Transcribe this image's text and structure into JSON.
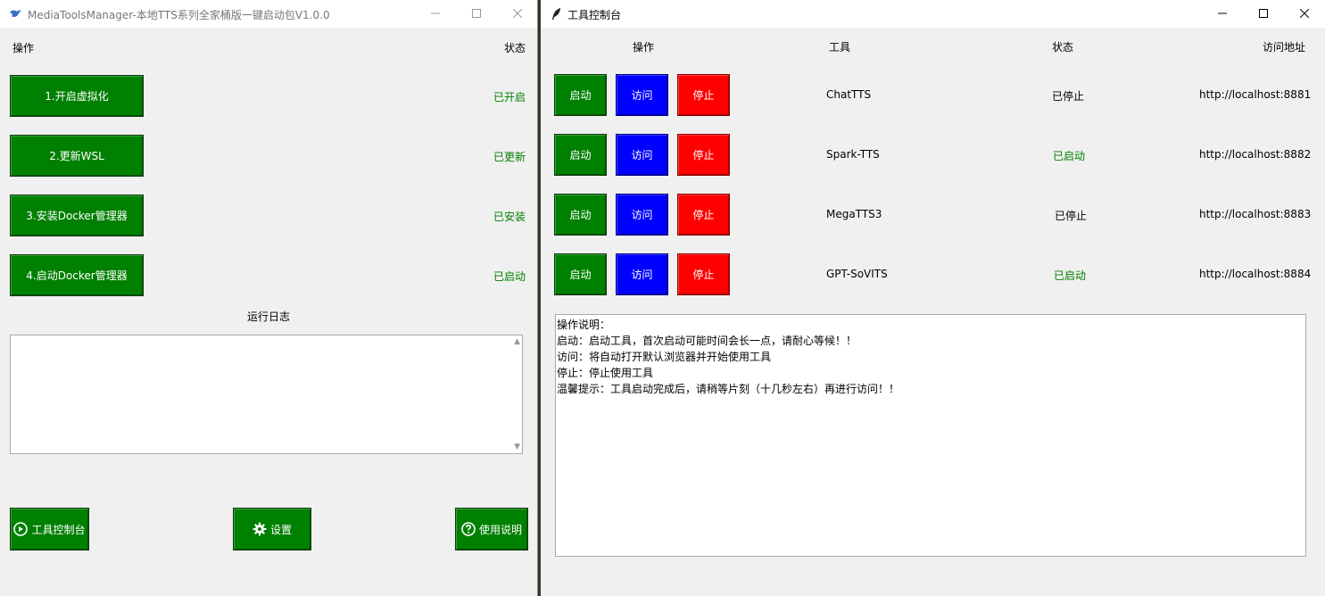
{
  "left_window": {
    "title": "MediaToolsManager-本地TTS系列全家桶版一键启动包V1.0.0",
    "header_op": "操作",
    "header_status": "状态",
    "steps": [
      {
        "label": "1.开启虚拟化",
        "status": "已开启"
      },
      {
        "label": "2.更新WSL",
        "status": "已更新"
      },
      {
        "label": "3.安装Docker管理器",
        "status": "已安装"
      },
      {
        "label": "4.启动Docker管理器",
        "status": "已启动"
      }
    ],
    "log_title": "运行日志",
    "log_text": "",
    "bottom_buttons": {
      "console": "工具控制台",
      "settings": "设置",
      "help": "使用说明"
    }
  },
  "right_window": {
    "title": "工具控制台",
    "headers": {
      "op": "操作",
      "tool": "工具",
      "status": "状态",
      "url": "访问地址"
    },
    "button_labels": {
      "start": "启动",
      "visit": "访问",
      "stop": "停止"
    },
    "tools": [
      {
        "name": "ChatTTS",
        "status": "已停止",
        "url": "http://localhost:8881"
      },
      {
        "name": "Spark-TTS",
        "status": "已启动",
        "url": "http://localhost:8882"
      },
      {
        "name": "MegaTTS3",
        "status": "已停止",
        "url": "http://localhost:8883"
      },
      {
        "name": "GPT-SoVITS",
        "status": "已启动",
        "url": "http://localhost:8884"
      }
    ],
    "help_lines": [
      "操作说明：",
      "启动：启动工具，首次启动可能时间会长一点，请耐心等候！！",
      "访问：将自动打开默认浏览器并开始使用工具",
      "停止：停止使用工具",
      "温馨提示：工具启动完成后，请稍等片刻（十几秒左右）再进行访问！！"
    ]
  },
  "colors": {
    "green": "#008000",
    "blue": "#0000ff",
    "red": "#ff0000",
    "status_green": "#008000"
  }
}
